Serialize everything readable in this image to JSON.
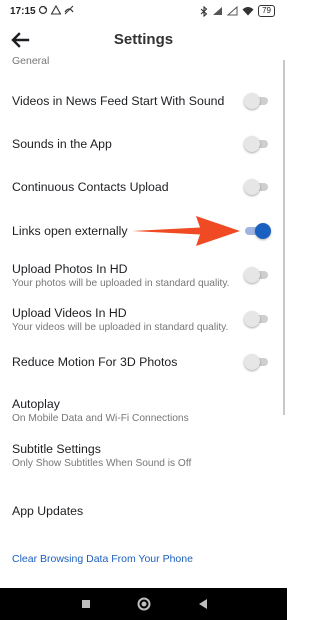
{
  "status_bar": {
    "time": "17:15",
    "battery": "79",
    "left_icons": [
      "sync-icon",
      "triangle-icon",
      "unknown-icon"
    ],
    "right_icons": [
      "bluetooth-icon",
      "signal-icon",
      "signal-icon",
      "wifi-icon",
      "battery-icon"
    ]
  },
  "header": {
    "title": "Settings"
  },
  "section_label": "General",
  "settings": [
    {
      "label": "Videos in News Feed Start With Sound",
      "toggle": false
    },
    {
      "label": "Sounds in the App",
      "toggle": false
    },
    {
      "label": "Continuous Contacts Upload",
      "toggle": false
    },
    {
      "label": "Links open externally",
      "toggle": true
    },
    {
      "label": "Upload Photos In HD",
      "sub": "Your photos will be uploaded in standard quality.",
      "toggle": false
    },
    {
      "label": "Upload Videos In HD",
      "sub": "Your videos will be uploaded in standard quality.",
      "toggle": false
    },
    {
      "label": "Reduce Motion For 3D Photos",
      "toggle": false
    },
    {
      "label": "Autoplay",
      "sub": "On Mobile Data and Wi-Fi Connections"
    },
    {
      "label": "Subtitle Settings",
      "sub": "Only Show Subtitles When Sound is Off"
    },
    {
      "label": "App Updates"
    }
  ],
  "clear_link": "Clear Browsing Data From Your Phone",
  "colors": {
    "accent": "#1b5fc0",
    "annotation_arrow": "#f04a24"
  },
  "nav_bar": {
    "icons": [
      "square-recents-icon",
      "circle-home-icon",
      "triangle-back-icon"
    ]
  }
}
